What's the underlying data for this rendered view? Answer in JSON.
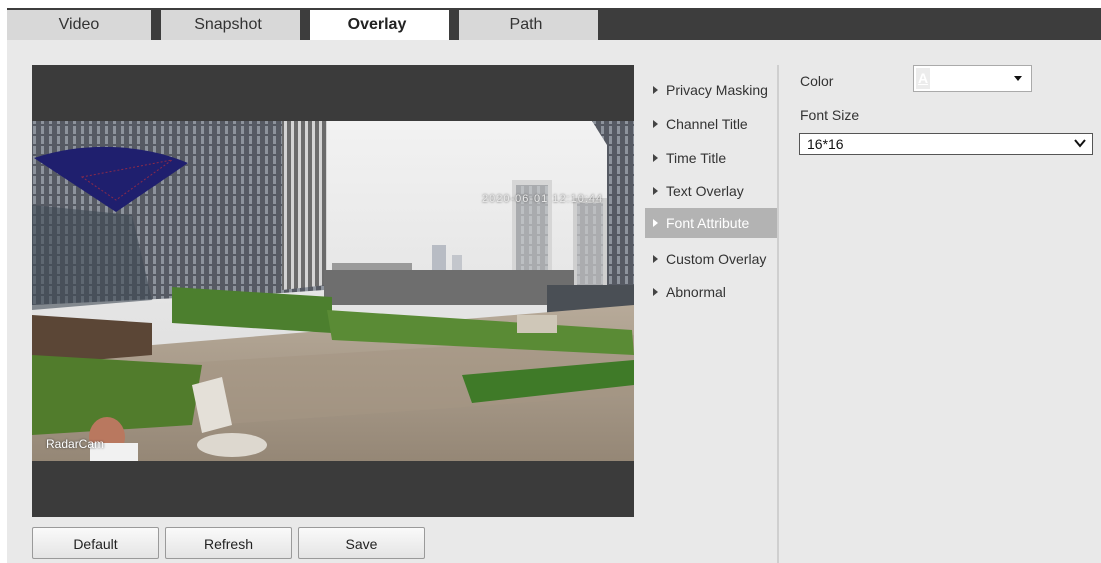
{
  "tabs": [
    {
      "label": "Video"
    },
    {
      "label": "Snapshot"
    },
    {
      "label": "Overlay",
      "active": true
    },
    {
      "label": "Path"
    }
  ],
  "preview": {
    "timestamp": "2020-06-01 12:10:44",
    "channel_title": "RadarCam"
  },
  "buttons": {
    "default": "Default",
    "refresh": "Refresh",
    "save": "Save"
  },
  "menu": {
    "items": [
      {
        "label": "Privacy Masking"
      },
      {
        "label": "Channel Title"
      },
      {
        "label": "Time Title"
      },
      {
        "label": "Text Overlay"
      },
      {
        "label": "Font Attribute",
        "active": true
      },
      {
        "label": "Custom Overlay"
      },
      {
        "label": "Abnormal"
      }
    ]
  },
  "settings": {
    "color_label": "Color",
    "color_swatch_glyph": "A",
    "font_size_label": "Font Size",
    "font_size_value": "16*16"
  },
  "colors": {
    "tabbar": "#3d3d3d",
    "tab": "#d8d8d8",
    "tab_active": "#ffffff",
    "panel": "#e9e9e9",
    "menu_active": "#b3b3b3",
    "privacy_mask": "#1f1f6e"
  }
}
